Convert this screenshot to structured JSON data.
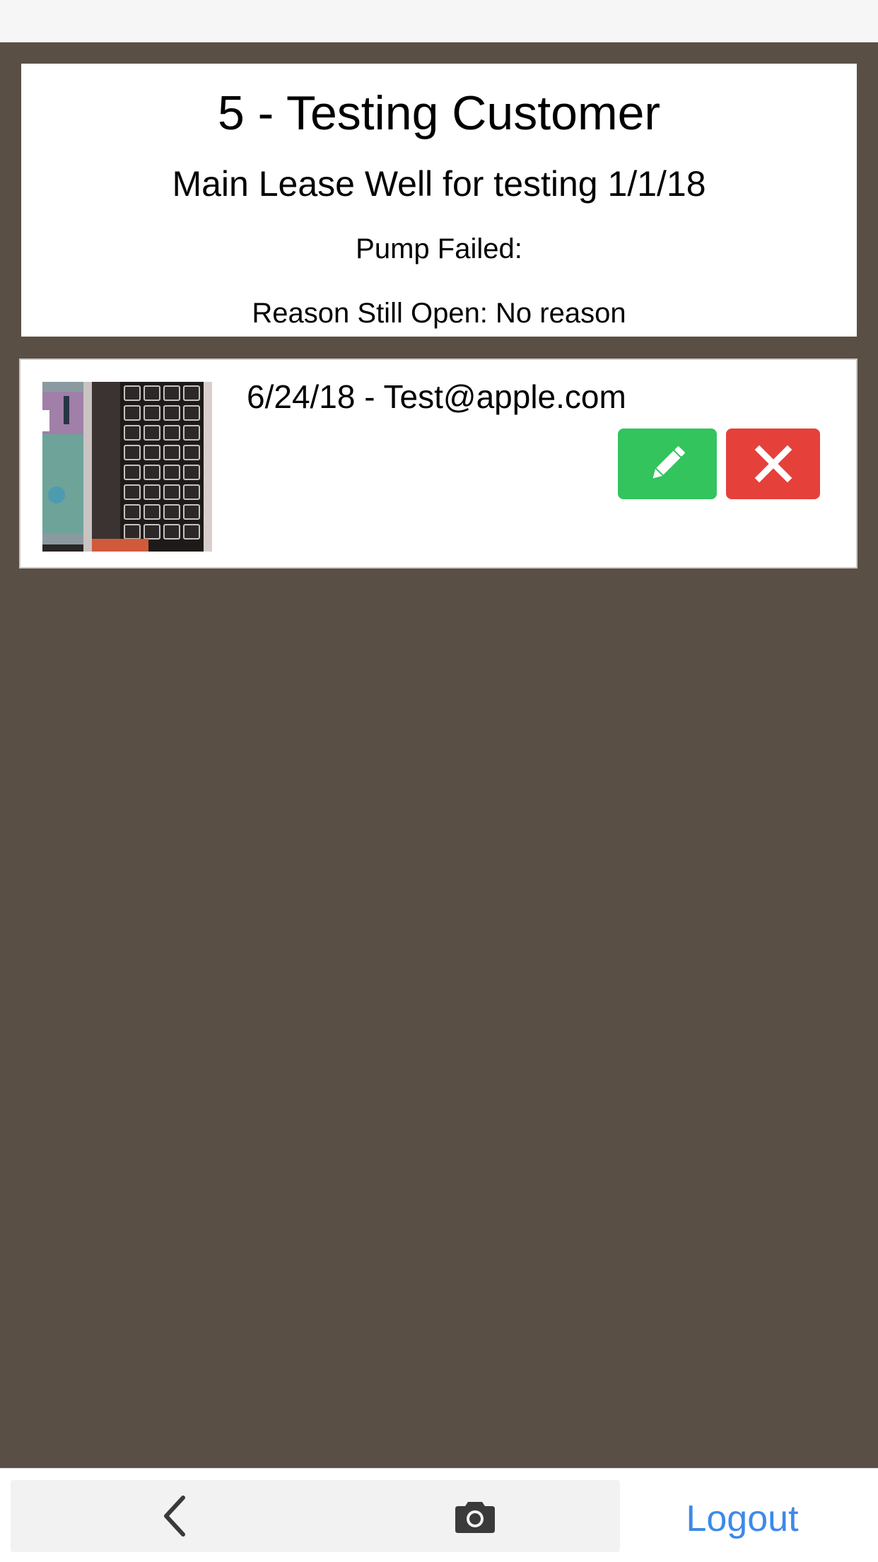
{
  "header": {
    "customer_title": "5 - Testing Customer",
    "lease_title": "Main Lease Well for testing 1/1/18",
    "pump_failed": "Pump Failed:",
    "reason_still_open": "Reason Still Open: No reason"
  },
  "entries": [
    {
      "text": "6/24/18 - Test@apple.com",
      "edit_icon": "pencil-icon",
      "delete_icon": "close-icon"
    }
  ],
  "bottom_bar": {
    "back_icon": "chevron-left-icon",
    "camera_icon": "camera-icon",
    "logout_label": "Logout"
  },
  "colors": {
    "background": "#5a4f44",
    "edit_button": "#33c45e",
    "delete_button": "#e6403b",
    "link": "#3d8ae8"
  }
}
